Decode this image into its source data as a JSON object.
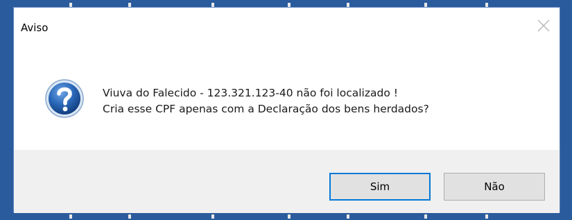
{
  "dialog": {
    "title": "Aviso",
    "message_line1": "Viuva do Falecido - 123.321.123-40 não foi localizado !",
    "message_line2": "Cria esse CPF apenas com a Declaração dos bens herdados?",
    "icon": "question-icon",
    "close_icon": "close-icon"
  },
  "buttons": {
    "yes_label": "Sim",
    "no_label": "Não"
  },
  "colors": {
    "desktop_background": "#2a5b9c",
    "default_button_border": "#0078d7",
    "icon_blue": "#1f5fa8"
  }
}
